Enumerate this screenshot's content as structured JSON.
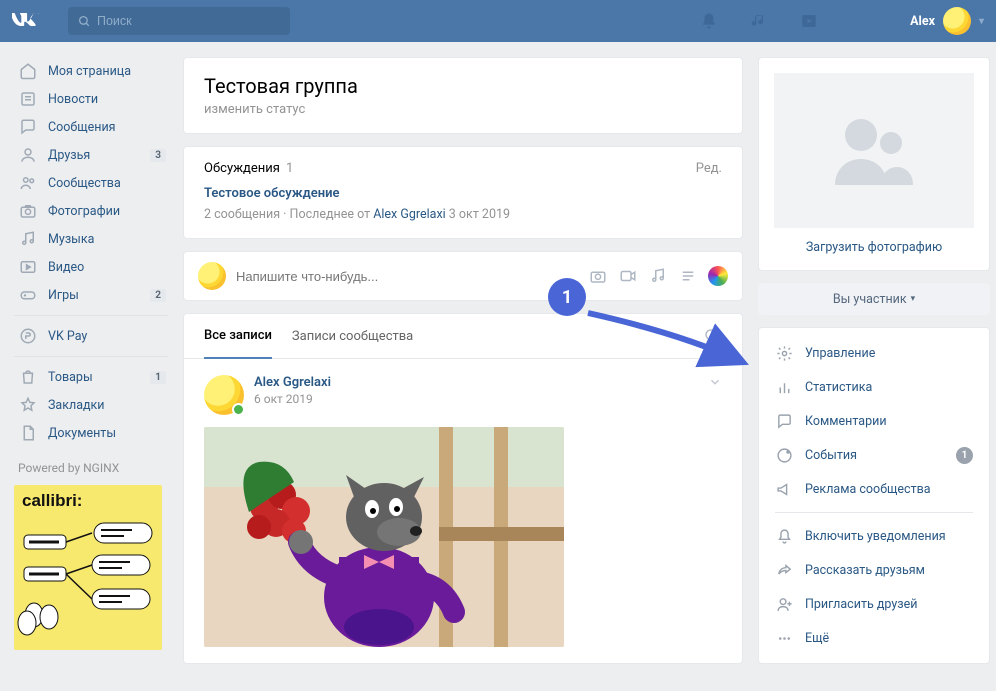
{
  "topbar": {
    "search_placeholder": "Поиск",
    "user_name": "Alex"
  },
  "nav": {
    "items": [
      {
        "icon": "home",
        "label": "Моя страница"
      },
      {
        "icon": "news",
        "label": "Новости"
      },
      {
        "icon": "msg",
        "label": "Сообщения"
      },
      {
        "icon": "friends",
        "label": "Друзья",
        "badge": "3"
      },
      {
        "icon": "groups",
        "label": "Сообщества"
      },
      {
        "icon": "photos",
        "label": "Фотографии"
      },
      {
        "icon": "music",
        "label": "Музыка"
      },
      {
        "icon": "video",
        "label": "Видео"
      },
      {
        "icon": "games",
        "label": "Игры",
        "badge": "2"
      },
      {
        "icon": "vkpay",
        "label": "VK Pay"
      }
    ],
    "secondary": [
      {
        "icon": "market",
        "label": "Товары",
        "badge": "1"
      },
      {
        "icon": "bookmarks",
        "label": "Закладки"
      },
      {
        "icon": "docs",
        "label": "Документы"
      }
    ],
    "powered": "Powered by NGINX",
    "ad": "callibri:"
  },
  "group": {
    "title": "Тестовая группа",
    "status_hint": "изменить статус"
  },
  "discussions": {
    "heading": "Обсуждения",
    "count": "1",
    "edit_label": "Ред.",
    "topic": "Тестовое обсуждение",
    "meta_prefix": "2 сообщения   ·   Последнее от ",
    "meta_author": "Alex Ggrelaxi",
    "meta_date": " 3 окт 2019"
  },
  "composer": {
    "placeholder": "Напишите что-нибудь..."
  },
  "tabs": {
    "all": "Все записи",
    "community": "Записи сообщества"
  },
  "post": {
    "author": "Alex Ggrelaxi",
    "date": "6 окт 2019"
  },
  "sidebar": {
    "upload_label": "Загрузить фотографию",
    "member_label": "Вы участник",
    "manage": "Управление",
    "stats": "Статистика",
    "comments": "Комментарии",
    "events": "События",
    "events_badge": "1",
    "ads": "Реклама сообщества",
    "notify": "Включить уведомления",
    "share": "Рассказать друзьям",
    "invite": "Пригласить друзей",
    "more": "Ещё"
  },
  "annotation": {
    "step": "1"
  }
}
